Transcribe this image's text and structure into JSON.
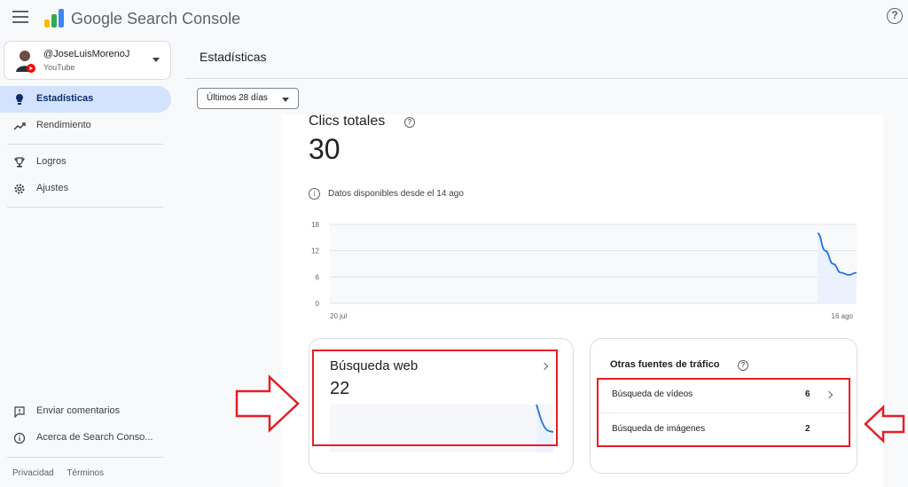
{
  "header": {
    "brand": "Google Search Console",
    "icons": {
      "menu": "hamburger-icon",
      "logo": "search-console-logo",
      "help": "help-icon"
    }
  },
  "sidebar": {
    "property": {
      "name": "@JoseLuisMorenoJ",
      "type": "YouTube"
    },
    "items": [
      {
        "label": "Estadísticas",
        "icon": "lightbulb-icon",
        "active": true
      },
      {
        "label": "Rendimiento",
        "icon": "trending-up-icon",
        "active": false
      },
      {
        "label": "Logros",
        "icon": "trophy-icon",
        "active": false
      },
      {
        "label": "Ajustes",
        "icon": "gear-icon",
        "active": false
      },
      {
        "label": "Enviar comentarios",
        "icon": "feedback-icon",
        "active": false
      },
      {
        "label": "Acerca de Search Conso...",
        "icon": "info-icon",
        "active": false
      }
    ],
    "footer": {
      "privacy": "Privacidad",
      "terms": "Términos"
    }
  },
  "main": {
    "title": "Estadísticas",
    "date_range": "Últimos 28 días",
    "total_clicks": {
      "label": "Clics totales",
      "value": "30"
    },
    "data_notice": "Datos disponibles desde el 14 ago",
    "web_search": {
      "label": "Búsqueda web",
      "value": "22"
    },
    "other_sources": {
      "title": "Otras fuentes de tráfico",
      "rows": [
        {
          "label": "Búsqueda de vídeos",
          "value": "6"
        },
        {
          "label": "Búsqueda de imágenes",
          "value": "2"
        }
      ]
    }
  },
  "chart_data": {
    "type": "area",
    "x_tick_labels": [
      "20 jul",
      "16 ago"
    ],
    "y_ticks": [
      "18",
      "12",
      "6",
      "0"
    ],
    "ylim": [
      0,
      18
    ],
    "grid": true,
    "series": [
      {
        "values": [
          16,
          12,
          9,
          7,
          6.5,
          7
        ]
      }
    ]
  },
  "colors": {
    "accent": "#1a73e8",
    "active_nav": "#d3e3fd",
    "annotation": "#e51e25"
  }
}
